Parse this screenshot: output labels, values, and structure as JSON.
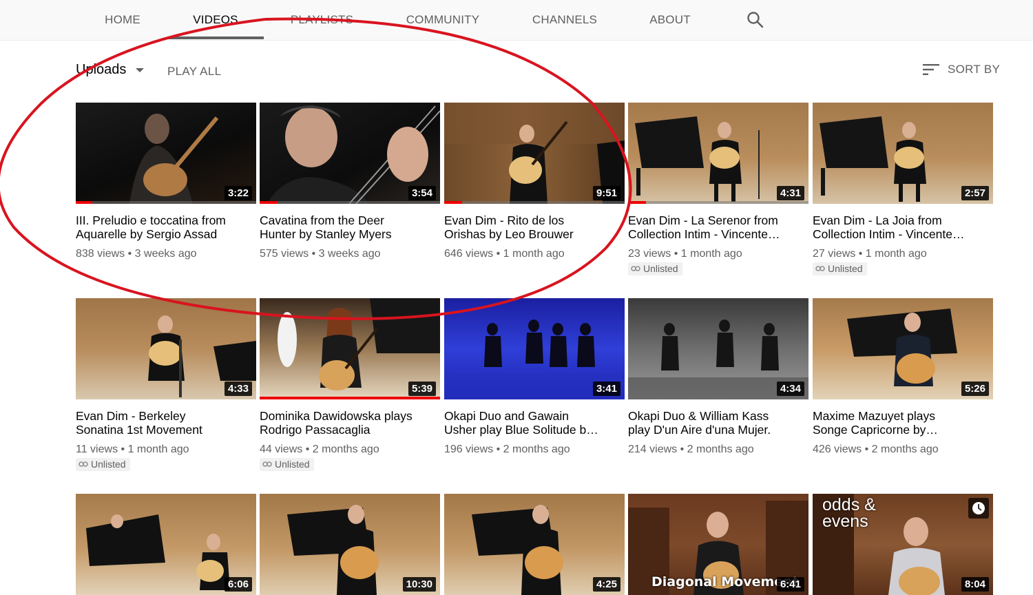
{
  "tabs": [
    {
      "label": "HOME"
    },
    {
      "label": "VIDEOS"
    },
    {
      "label": "PLAYLISTS"
    },
    {
      "label": "COMMUNITY"
    },
    {
      "label": "CHANNELS"
    },
    {
      "label": "ABOUT"
    }
  ],
  "active_tab": "VIDEOS",
  "controls": {
    "uploads_label": "Uploads",
    "play_all_label": "PLAY ALL",
    "sort_by_label": "SORT BY"
  },
  "colors": {
    "progress_red": "#ee0000",
    "annotation_red": "#d8141f"
  },
  "videos": [
    {
      "title": "III. Preludio e toccatina from Aquarelle by Sergio Assad",
      "views": "838 views",
      "age": "3 weeks ago",
      "duration": "3:22",
      "progress": 0.09,
      "unlisted": false
    },
    {
      "title": "Cavatina from the Deer Hunter by Stanley Myers",
      "views": "575 views",
      "age": "3 weeks ago",
      "duration": "3:54",
      "progress": 0.1,
      "unlisted": false
    },
    {
      "title": "Evan Dim - Rito de los Orishas by Leo Brouwer",
      "views": "646 views",
      "age": "1 month ago",
      "duration": "9:51",
      "progress": 0.1,
      "unlisted": false
    },
    {
      "title": "Evan Dim - La Serenor from Collection Intim - Vincente…",
      "views": "23 views",
      "age": "1 month ago",
      "duration": "4:31",
      "progress": 0.1,
      "unlisted": true
    },
    {
      "title": "Evan Dim - La Joia from Collection Intim - Vincente…",
      "views": "27 views",
      "age": "1 month ago",
      "duration": "2:57",
      "progress": 0,
      "unlisted": true
    },
    {
      "title": "Evan Dim - Berkeley Sonatina 1st Movement",
      "views": "11 views",
      "age": "1 month ago",
      "duration": "4:33",
      "progress": 0,
      "unlisted": true
    },
    {
      "title": "Dominika Dawidowska plays Rodrigo Passacaglia",
      "views": "44 views",
      "age": "2 months ago",
      "duration": "5:39",
      "progress": 1.0,
      "unlisted": true
    },
    {
      "title": "Okapi Duo and Gawain Usher play Blue Solitude by Sergio…",
      "views": "196 views",
      "age": "2 months ago",
      "duration": "3:41",
      "progress": 0,
      "unlisted": false
    },
    {
      "title": "Okapi Duo & William Kass play D'un Aire d'una Mujer.",
      "views": "214 views",
      "age": "2 months ago",
      "duration": "4:34",
      "progress": 0,
      "unlisted": false
    },
    {
      "title": "Maxime Mazuyet plays Songe Capricorne by Rolan…",
      "views": "426 views",
      "age": "2 months ago",
      "duration": "5:26",
      "progress": 0,
      "unlisted": false
    },
    {
      "title": "",
      "views": "",
      "age": "",
      "duration": "6:06",
      "progress": 0,
      "unlisted": false
    },
    {
      "title": "",
      "views": "",
      "age": "",
      "duration": "10:30",
      "progress": 0,
      "unlisted": false
    },
    {
      "title": "",
      "views": "",
      "age": "",
      "duration": "4:25",
      "progress": 0,
      "unlisted": false
    },
    {
      "title": "",
      "views": "",
      "age": "",
      "duration": "6:41",
      "progress": 0,
      "unlisted": false,
      "overlay_text": "Diagonal Movement"
    },
    {
      "title": "",
      "views": "",
      "age": "",
      "duration": "8:04",
      "progress": 0,
      "unlisted": false,
      "overlay_text": "odds & evens"
    }
  ],
  "unlisted_label": "Unlisted",
  "meta_separator": "•"
}
